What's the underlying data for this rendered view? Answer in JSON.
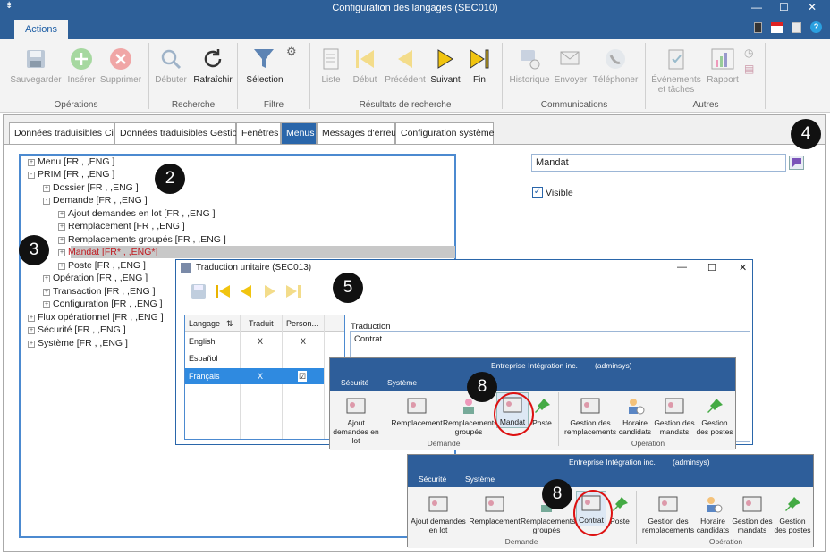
{
  "window": {
    "title": "Configuration des langages (SEC010)"
  },
  "ribbon": {
    "tab_label": "Actions",
    "groups": {
      "ops": "Opérations",
      "search": "Recherche",
      "filter": "Filtre",
      "results": "Résultats de recherche",
      "comms": "Communications",
      "others": "Autres"
    },
    "buttons": {
      "save": "Sauvegarder",
      "insert": "Insérer",
      "delete": "Supprimer",
      "start": "Débuter",
      "refresh": "Rafraîchir",
      "selection": "Sélection",
      "list": "Liste",
      "first": "Début",
      "previous": "Précédent",
      "next": "Suivant",
      "last": "Fin",
      "history": "Historique",
      "send": "Envoyer",
      "phone": "Téléphoner",
      "events": "Événements et tâches",
      "report": "Rapport"
    }
  },
  "tabs": [
    "Données traduisibles Cie",
    "Données traduisibles Gestion",
    "Fenêtres",
    "Menus",
    "Messages d'erreur",
    "Configuration système"
  ],
  "tree": [
    {
      "sym": "+",
      "label": "Menu [FR ,     ,ENG ]"
    },
    {
      "sym": "-",
      "label": "PRIM [FR ,     ,ENG ]"
    },
    {
      "sym": "+",
      "label": "Dossier [FR ,     ,ENG ]"
    },
    {
      "sym": "-",
      "label": "Demande [FR ,     ,ENG ]"
    },
    {
      "sym": "+",
      "label": "Ajout demandes en lot [FR ,     ,ENG ]"
    },
    {
      "sym": "+",
      "label": "Remplacement [FR ,     ,ENG ]"
    },
    {
      "sym": "+",
      "label": "Remplacements groupés [FR ,     ,ENG ]"
    },
    {
      "sym": "+",
      "label": "Mandat [FR* ,     ,ENG*]"
    },
    {
      "sym": "+",
      "label": "Poste [FR ,     ,ENG ]"
    },
    {
      "sym": "+",
      "label": "Opération [FR ,     ,ENG ]"
    },
    {
      "sym": "+",
      "label": "Transaction [FR ,     ,ENG ]"
    },
    {
      "sym": "+",
      "label": "Configuration [FR ,     ,ENG ]"
    },
    {
      "sym": "+",
      "label": "Flux opérationnel [FR ,     ,ENG ]"
    },
    {
      "sym": "+",
      "label": "Sécurité [FR ,     ,ENG ]"
    },
    {
      "sym": "+",
      "label": "Système [FR ,     ,ENG ]"
    }
  ],
  "detail": {
    "name_value": "Mandat",
    "visible_label": "Visible",
    "visible_checked": true
  },
  "dialog": {
    "title": "Traduction unitaire (SEC013)",
    "grid_headers": [
      "Langage",
      "Traduit",
      "Person..."
    ],
    "grid_rows": [
      {
        "lang": "English",
        "translated": "X",
        "custom": "X"
      },
      {
        "lang": "Español",
        "translated": "",
        "custom": ""
      },
      {
        "lang": "Français",
        "translated": "X",
        "custom": "☑"
      }
    ],
    "translation_label": "Traduction",
    "translation_value": "Contrat"
  },
  "popup_before": {
    "company": "Entreprise Intégration inc.",
    "user": "(adminsys)",
    "tabs": [
      "Sécurité",
      "Système"
    ],
    "demande": [
      "Ajout demandes en lot",
      "Remplacement",
      "Remplacements groupés",
      "Mandat",
      "Poste"
    ],
    "operation": [
      "Gestion des remplacements",
      "Horaire candidats",
      "Gestion des mandats",
      "Gestion des postes"
    ],
    "group_demande": "Demande",
    "group_operation": "Opération"
  },
  "popup_after": {
    "company": "Entreprise Intégration inc.",
    "user": "(adminsys)",
    "tabs": [
      "Sécurité",
      "Système"
    ],
    "demande": [
      "Ajout demandes en lot",
      "Remplacement",
      "Remplacements groupés",
      "Contrat",
      "Poste"
    ],
    "operation": [
      "Gestion des remplacements",
      "Horaire candidats",
      "Gestion des mandats",
      "Gestion des postes"
    ],
    "group_demande": "Demande",
    "group_operation": "Opération"
  },
  "callouts": [
    "2",
    "3",
    "4",
    "5",
    "8",
    "8"
  ],
  "colors": {
    "accent": "#2d5f98",
    "selected_tab": "#2a66aa",
    "highlight_ring": "#dd1111"
  }
}
